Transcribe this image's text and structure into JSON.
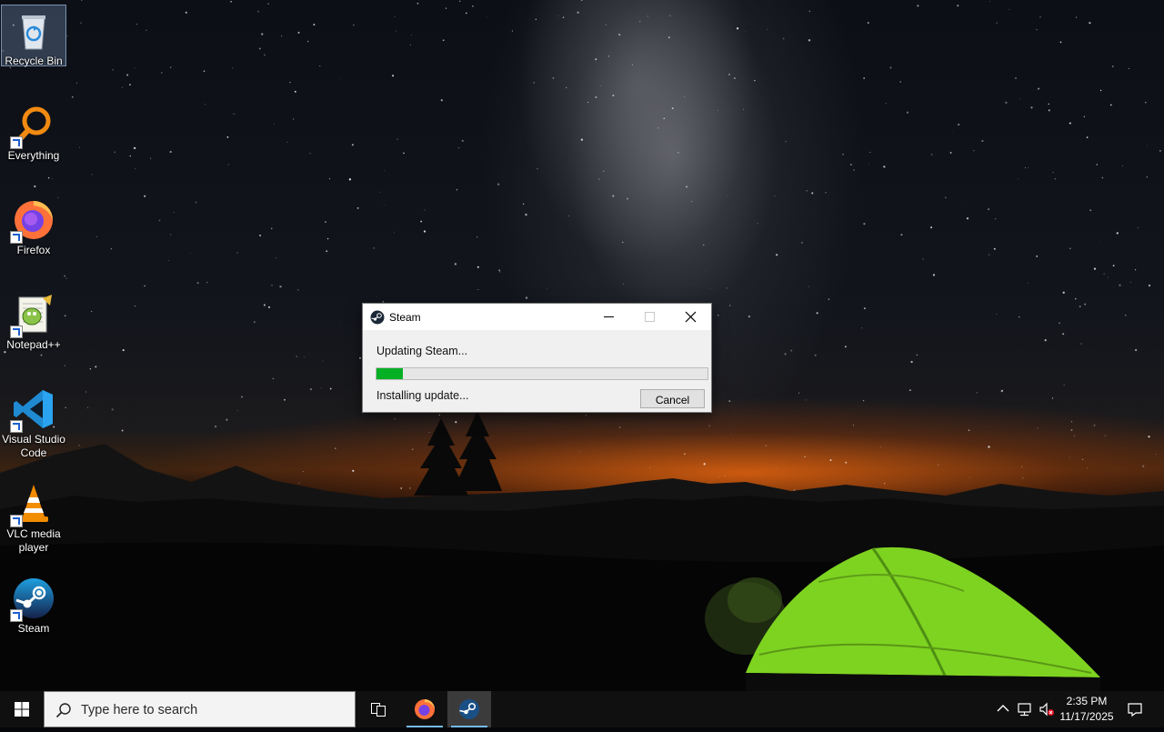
{
  "desktop": {
    "icons": [
      {
        "label": "Recycle Bin",
        "icon": "recycle-bin-icon"
      },
      {
        "label": "Everything",
        "icon": "everything-search-icon"
      },
      {
        "label": "Firefox",
        "icon": "firefox-icon"
      },
      {
        "label": "Notepad++",
        "icon": "notepad-plus-plus-icon"
      },
      {
        "label": "Visual Studio Code",
        "icon": "vscode-icon"
      },
      {
        "label": "VLC media player",
        "icon": "vlc-icon"
      },
      {
        "label": "Steam",
        "icon": "steam-icon"
      }
    ]
  },
  "dialog": {
    "title": "Steam",
    "status": "Updating Steam...",
    "progress_fraction": 0.08,
    "detail": "Installing update...",
    "cancel_label": "Cancel"
  },
  "taskbar": {
    "search_placeholder": "Type here to search",
    "apps": [
      {
        "icon": "task-view-icon",
        "active": false
      },
      {
        "icon": "firefox-icon",
        "active": false,
        "running": true
      },
      {
        "icon": "steam-icon",
        "active": true,
        "running": true
      }
    ],
    "time": "2:35 PM",
    "date": "11/17/2025"
  },
  "colors": {
    "progress_fill": "#06b025",
    "taskbar_bg": "#101010",
    "accent_underline": "#76b9ed"
  }
}
